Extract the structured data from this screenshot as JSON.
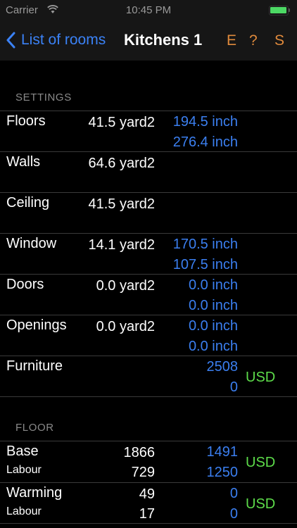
{
  "status_bar": {
    "carrier": "Carrier",
    "time": "10:45 PM",
    "battery_color": "#4cd964"
  },
  "nav": {
    "back_label": "List of rooms",
    "title": "Kitchens 1",
    "actions": [
      "E",
      "?",
      "S"
    ],
    "accent_color": "#3b82f6",
    "action_color": "#e08a3c"
  },
  "sections": {
    "settings": "SETTINGS",
    "floor": "FLOOR"
  },
  "settings_rows": [
    {
      "label": "Floors",
      "area": "41.5 yard2",
      "dim1": "194.5 inch",
      "dim2": "276.4 inch"
    },
    {
      "label": "Walls",
      "area": "64.6 yard2",
      "dim1": "",
      "dim2": ""
    },
    {
      "label": "Ceiling",
      "area": "41.5 yard2",
      "dim1": "",
      "dim2": ""
    },
    {
      "label": "Window",
      "area": "14.1 yard2",
      "dim1": "170.5 inch",
      "dim2": "107.5 inch"
    },
    {
      "label": "Doors",
      "area": "0.0 yard2",
      "dim1": "0.0 inch",
      "dim2": "0.0 inch"
    },
    {
      "label": "Openings",
      "area": "0.0 yard2",
      "dim1": "0.0 inch",
      "dim2": "0.0 inch"
    },
    {
      "label": "Furniture",
      "area": "",
      "dim1": "2508",
      "dim2": "0",
      "currency": "USD"
    }
  ],
  "floor_rows": [
    {
      "label": "Base",
      "sublabel": "Labour",
      "qty1": "1866",
      "qty2": "729",
      "price1": "1491",
      "price2": "1250",
      "currency": "USD"
    },
    {
      "label": "Warming",
      "sublabel": "Labour",
      "qty1": "49",
      "qty2": "17",
      "price1": "0",
      "price2": "0",
      "currency": "USD"
    }
  ]
}
